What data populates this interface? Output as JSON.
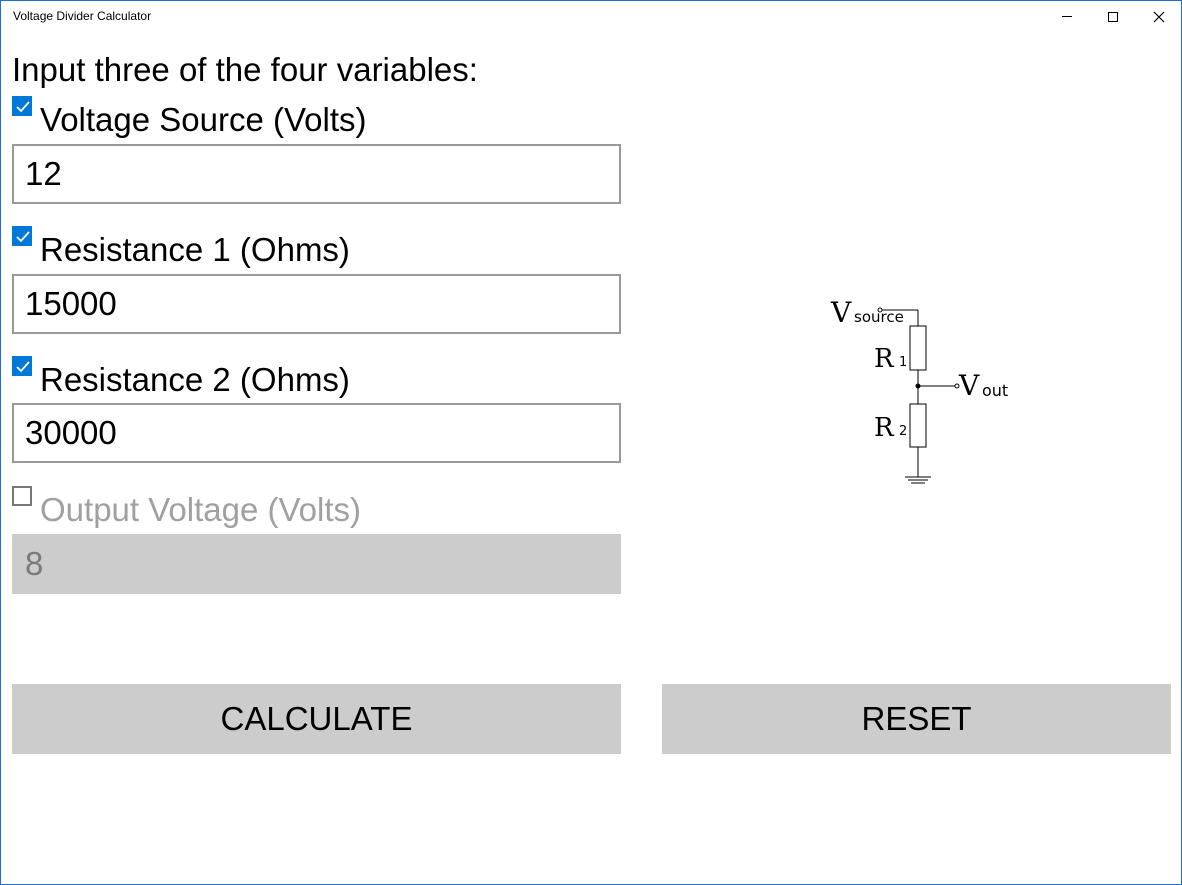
{
  "window": {
    "title": "Voltage Divider Calculator"
  },
  "heading": "Input three of the four variables:",
  "fields": [
    {
      "label": "Voltage Source (Volts)",
      "value": "12",
      "checked": true,
      "enabled": true
    },
    {
      "label": "Resistance 1 (Ohms)",
      "value": "15000",
      "checked": true,
      "enabled": true
    },
    {
      "label": "Resistance 2 (Ohms)",
      "value": "30000",
      "checked": true,
      "enabled": true
    },
    {
      "label": "Output Voltage (Volts)",
      "value": "8",
      "checked": false,
      "enabled": false
    }
  ],
  "buttons": {
    "calculate": "CALCULATE",
    "reset": "RESET"
  },
  "diagram": {
    "vsource_main": "V",
    "vsource_sub": "source",
    "r1_main": "R",
    "r1_sub": "1",
    "r2_main": "R",
    "r2_sub": "2",
    "vout_main": "V",
    "vout_sub": "out"
  },
  "colors": {
    "accent": "#0078d7",
    "button_bg": "#cccccc",
    "disabled_text": "#a0a0a0"
  }
}
